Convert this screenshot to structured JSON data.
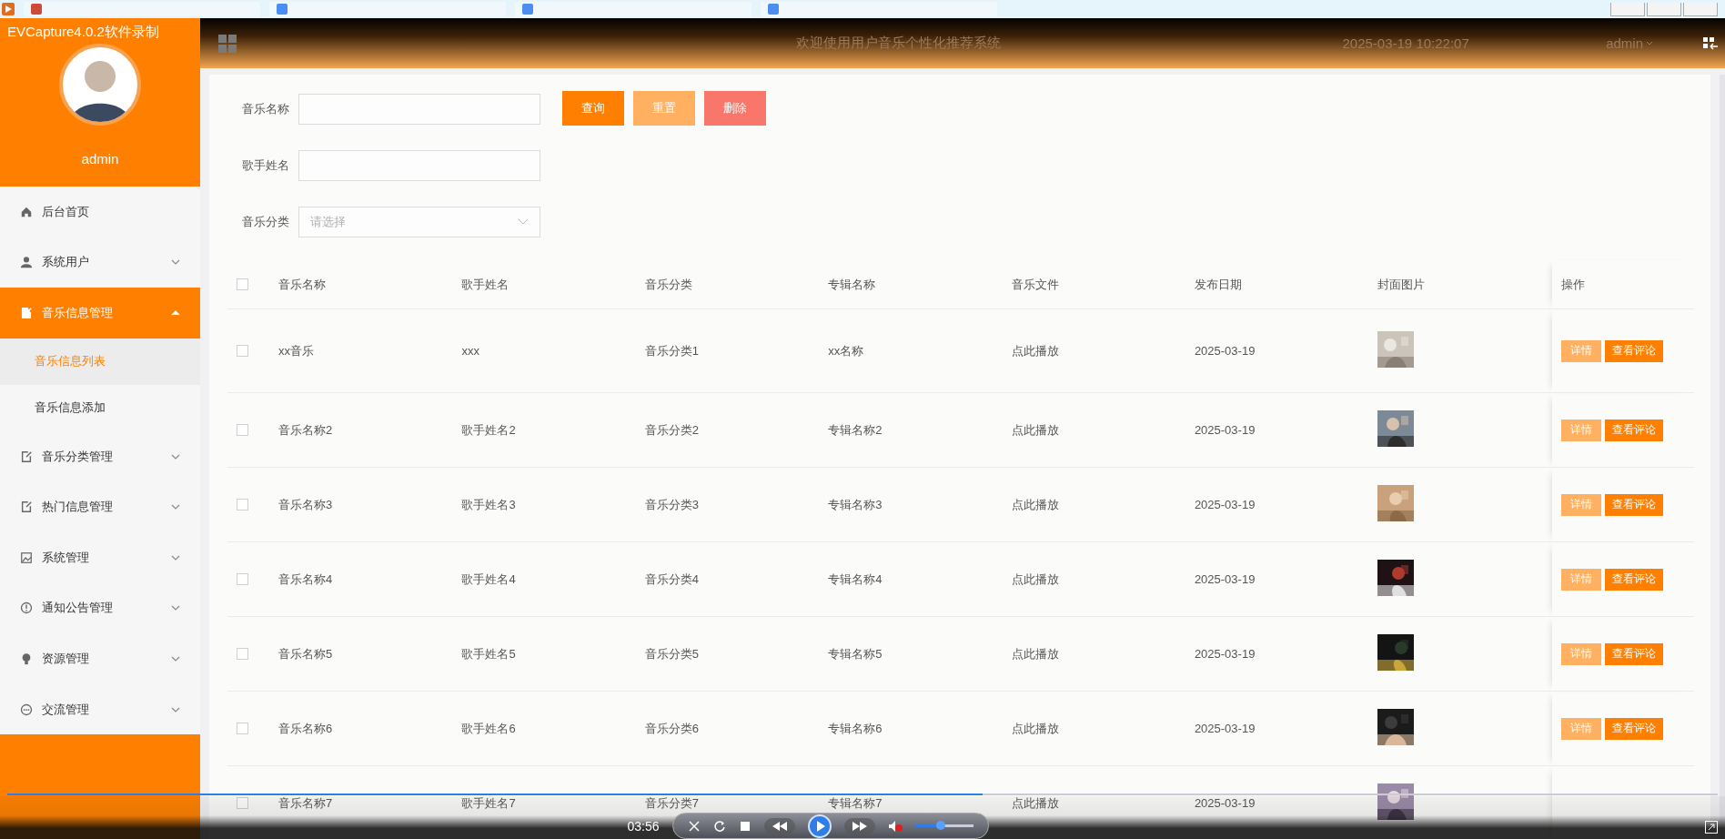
{
  "capture_label": "EVCapture4.0.2软件录制",
  "header": {
    "title": "欢迎使用用户音乐个性化推荐系统",
    "datetime": "2025-03-19 10:22:07",
    "user": "admin"
  },
  "sidebar": {
    "username": "admin",
    "items": [
      {
        "label": "后台首页",
        "selected": false
      },
      {
        "label": "系统用户",
        "selected": false,
        "expanded": false
      },
      {
        "label": "音乐信息管理",
        "selected": true,
        "expanded": true,
        "children": [
          {
            "label": "音乐信息列表",
            "selected": true
          },
          {
            "label": "音乐信息添加",
            "selected": false
          }
        ]
      },
      {
        "label": "音乐分类管理",
        "selected": false,
        "expanded": false
      },
      {
        "label": "热门信息管理",
        "selected": false,
        "expanded": false
      },
      {
        "label": "系统管理",
        "selected": false,
        "expanded": false
      },
      {
        "label": "通知公告管理",
        "selected": false,
        "expanded": false
      },
      {
        "label": "资源管理",
        "selected": false,
        "expanded": false
      },
      {
        "label": "交流管理",
        "selected": false,
        "expanded": false
      }
    ]
  },
  "search": {
    "fields": [
      {
        "kind": "text",
        "label": "音乐名称"
      },
      {
        "kind": "text",
        "label": "歌手姓名"
      },
      {
        "kind": "select",
        "label": "音乐分类",
        "placeholder": "请选择"
      }
    ],
    "buttons": [
      {
        "kind": "primary",
        "label": "查询"
      },
      {
        "kind": "warning",
        "label": "重置"
      },
      {
        "kind": "danger",
        "label": "删除"
      }
    ]
  },
  "table": {
    "select_all": {
      "checked": false
    },
    "columns": [
      "音乐名称",
      "歌手姓名",
      "音乐分类",
      "专辑名称",
      "音乐文件",
      "发布日期",
      "封面图片",
      "操作"
    ],
    "rows": [
      {
        "checked": false,
        "cells": [
          "xx音乐",
          "xxx",
          "音乐分类1",
          "xx名称",
          "点此播放",
          "2025-03-19"
        ],
        "cover": {
          "kind": "picture"
        },
        "actions": [
          "详情",
          "查看评论"
        ]
      },
      {
        "checked": false,
        "cells": [
          "音乐名称2",
          "歌手姓名2",
          "音乐分类2",
          "专辑名称2",
          "点此播放",
          "2025-03-19"
        ],
        "cover": {
          "kind": "picture"
        },
        "actions": [
          "详情",
          "查看评论"
        ]
      },
      {
        "checked": false,
        "cells": [
          "音乐名称3",
          "歌手姓名3",
          "音乐分类3",
          "专辑名称3",
          "点此播放",
          "2025-03-19"
        ],
        "cover": {
          "kind": "picture"
        },
        "actions": [
          "详情",
          "查看评论"
        ]
      },
      {
        "checked": false,
        "cells": [
          "音乐名称4",
          "歌手姓名4",
          "音乐分类4",
          "专辑名称4",
          "点此播放",
          "2025-03-19"
        ],
        "cover": {
          "kind": "picture"
        },
        "actions": [
          "详情",
          "查看评论"
        ]
      },
      {
        "checked": false,
        "cells": [
          "音乐名称5",
          "歌手姓名5",
          "音乐分类5",
          "专辑名称5",
          "点此播放",
          "2025-03-19"
        ],
        "cover": {
          "kind": "picture"
        },
        "actions": [
          "详情",
          "查看评论"
        ]
      },
      {
        "checked": false,
        "cells": [
          "音乐名称6",
          "歌手姓名6",
          "音乐分类6",
          "专辑名称6",
          "点此播放",
          "2025-03-19"
        ],
        "cover": {
          "kind": "picture"
        },
        "actions": [
          "详情",
          "查看评论"
        ]
      },
      {
        "checked": false,
        "cells": [
          "音乐名称7",
          "歌手姓名7",
          "音乐分类7",
          "专辑名称7",
          "点此播放",
          "2025-03-19"
        ],
        "cover": {
          "kind": "picture"
        }
      }
    ]
  },
  "player": {
    "time": "03:56",
    "level": 0.57,
    "volume": {
      "level": 0.45
    }
  }
}
